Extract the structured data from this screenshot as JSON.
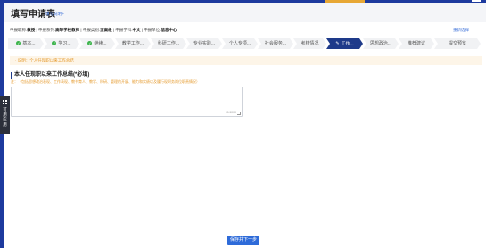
{
  "colors": {
    "brand_blue": "#1d3a9e",
    "active_step": "#1e3a8a",
    "accent_orange": "#e59a2d",
    "success_green": "#3bb34a",
    "button_blue": "#2e6bd9"
  },
  "header": {
    "title": "填写申请表",
    "help_link": "填写说明>"
  },
  "info": {
    "items": [
      {
        "label": "申报职称:",
        "value": "教授"
      },
      {
        "label": "申报系列:",
        "value": "高等学校教师"
      },
      {
        "label": "申报类别:",
        "value": "正高级"
      },
      {
        "label": "申报学科:",
        "value": "中文"
      },
      {
        "label": "申报单位:",
        "value": "信息中心"
      }
    ],
    "reselect": "重新选择"
  },
  "steps": [
    {
      "label": "基本...",
      "status": "done"
    },
    {
      "label": "学习...",
      "status": "done"
    },
    {
      "label": "继续...",
      "status": "done"
    },
    {
      "label": "教学工作...",
      "status": "todo"
    },
    {
      "label": "科研工作...",
      "status": "todo"
    },
    {
      "label": "专业实践...",
      "status": "todo"
    },
    {
      "label": "个人专项...",
      "status": "todo"
    },
    {
      "label": "社会服务...",
      "status": "todo"
    },
    {
      "label": "考核情况",
      "status": "todo"
    },
    {
      "label": "工作...",
      "status": "active",
      "icon": "pencil-icon"
    },
    {
      "label": "思想政治...",
      "status": "todo"
    },
    {
      "label": "推荐建议",
      "status": "todo"
    },
    {
      "label": "提交预览",
      "status": "todo"
    }
  ],
  "tip": "· 说明：个人任现职以来工作总结",
  "section": {
    "title": "本人任现职以来工作总结(*必填)",
    "note": "注：（包括思想政治表现、工作表现、教书育人、教学、科研、管理的开展、能力和实绩以及履行现职务岗位职责情况）",
    "textarea_value": "",
    "counter": "0/4000"
  },
  "save_button": "保存并下一步",
  "side_tab": {
    "icon": "grid-icon",
    "label": "可用应用"
  }
}
